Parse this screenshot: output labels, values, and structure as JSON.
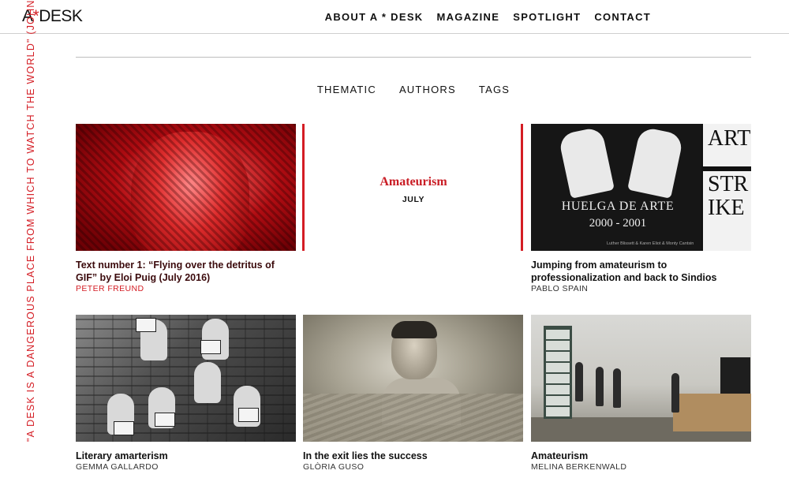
{
  "header": {
    "logo": {
      "prefix": "A",
      "star": "*",
      "suffix": "DESK"
    },
    "nav": [
      {
        "label": "ABOUT A * DESK"
      },
      {
        "label": "MAGAZINE"
      },
      {
        "label": "SPOTLIGHT"
      },
      {
        "label": "CONTACT"
      }
    ]
  },
  "side_quote": "\"A DESK IS A DANGEROUS PLACE FROM WHICH TO WATCH THE WORLD\" (JOHN",
  "subnav": [
    {
      "label": "THEMATIC"
    },
    {
      "label": "AUTHORS"
    },
    {
      "label": "TAGS"
    }
  ],
  "feature": {
    "title": "Amateurism",
    "subtitle": "JULY"
  },
  "articles": [
    {
      "title": "Text number 1: “Flying over the detritus of GIF” by Eloi Puig (July 2016)",
      "author": "PETER FREUND",
      "author_color": "#d41d24",
      "title_color": "#3b0a0c"
    },
    {
      "title": "Jumping from amateurism to professionalization and back to Sindios",
      "author": "PABLO SPAIN",
      "image_text": {
        "huelga": "HUELGA DE ARTE",
        "years": "2000 - 2001",
        "art": "ART",
        "strike": "STR\nIKE",
        "credit": "Luther Blissett & Karen Eliot & Monty Cantsin"
      }
    },
    {
      "title": "Literary amarterism",
      "author": "GEMMA GALLARDO"
    },
    {
      "title": "In the exit lies the success",
      "author": "GLÒRIA GUSO"
    },
    {
      "title": "Amateurism",
      "author": "MELINA BERKENWALD"
    }
  ],
  "colors": {
    "accent": "#d41d24",
    "text": "#111111",
    "rule": "#bdbdbd"
  }
}
